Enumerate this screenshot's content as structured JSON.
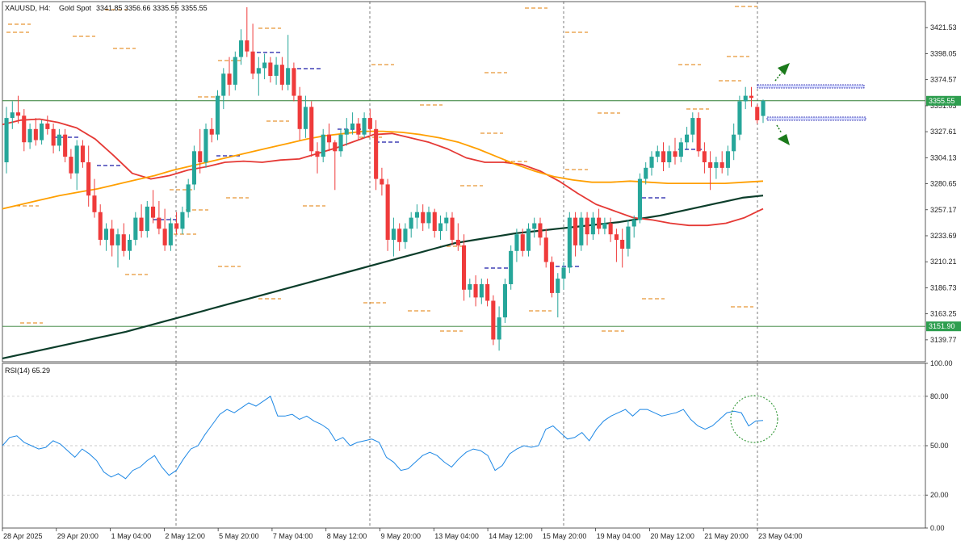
{
  "header": {
    "symbol": "XAUUSD, H4:",
    "description": "Gold Spot",
    "ohlc": "3341.85 3356.66 3335.55 3355.55"
  },
  "rsi_header": "RSI(14) 65.29",
  "colors": {
    "bull": "#26a69a",
    "bear": "#ef3b3b",
    "ma_fast": "#ff9f00",
    "ma_mid": "#e53935",
    "ma_slow": "#0b3d2a",
    "rsi": "#1e88e5",
    "pivot_orange": "#e07b00",
    "pivot_blue": "#1a1aa6",
    "level": "#2e7d32",
    "arrow": "#1b7a1b"
  },
  "price_axis": {
    "ticks": [
      "3421.53",
      "3398.05",
      "3374.57",
      "3351.03",
      "3327.61",
      "3304.13",
      "3280.65",
      "3257.17",
      "3233.69",
      "3210.21",
      "3186.73",
      "3163.25",
      "3139.77"
    ],
    "current_price_label": "3355.55",
    "support_label": "3151.90"
  },
  "rsi_axis": {
    "ticks": [
      "100.00",
      "80.00",
      "50.00",
      "20.00",
      "0.00"
    ]
  },
  "time_axis": {
    "labels": [
      "28 Apr 2025",
      "29 Apr 20:00",
      "1 May 04:00",
      "2 May 12:00",
      "5 May 20:00",
      "7 May 04:00",
      "8 May 12:00",
      "9 May 20:00",
      "13 May 04:00",
      "14 May 12:00",
      "15 May 20:00",
      "19 May 04:00",
      "20 May 12:00",
      "21 May 20:00",
      "23 May 04:00"
    ]
  },
  "chart_data": {
    "type": "candlestick",
    "symbol": "XAUUSD",
    "timeframe": "H4",
    "ylim": [
      3120,
      3445
    ],
    "levels": [
      3355.55,
      3151.9
    ],
    "candles": [
      {
        "o": 3300,
        "h": 3350,
        "l": 3290,
        "c": 3340
      },
      {
        "o": 3340,
        "h": 3355,
        "l": 3330,
        "c": 3345
      },
      {
        "o": 3345,
        "h": 3360,
        "l": 3335,
        "c": 3342
      },
      {
        "o": 3342,
        "h": 3348,
        "l": 3310,
        "c": 3318
      },
      {
        "o": 3318,
        "h": 3335,
        "l": 3312,
        "c": 3330
      },
      {
        "o": 3330,
        "h": 3340,
        "l": 3315,
        "c": 3320
      },
      {
        "o": 3320,
        "h": 3338,
        "l": 3316,
        "c": 3335
      },
      {
        "o": 3335,
        "h": 3342,
        "l": 3325,
        "c": 3330
      },
      {
        "o": 3330,
        "h": 3335,
        "l": 3308,
        "c": 3315
      },
      {
        "o": 3315,
        "h": 3330,
        "l": 3310,
        "c": 3325
      },
      {
        "o": 3325,
        "h": 3330,
        "l": 3300,
        "c": 3305
      },
      {
        "o": 3305,
        "h": 3312,
        "l": 3285,
        "c": 3290
      },
      {
        "o": 3290,
        "h": 3320,
        "l": 3275,
        "c": 3315
      },
      {
        "o": 3315,
        "h": 3320,
        "l": 3295,
        "c": 3300
      },
      {
        "o": 3300,
        "h": 3315,
        "l": 3260,
        "c": 3270
      },
      {
        "o": 3270,
        "h": 3285,
        "l": 3250,
        "c": 3255
      },
      {
        "o": 3255,
        "h": 3262,
        "l": 3225,
        "c": 3230
      },
      {
        "o": 3230,
        "h": 3245,
        "l": 3220,
        "c": 3240
      },
      {
        "o": 3240,
        "h": 3248,
        "l": 3215,
        "c": 3225
      },
      {
        "o": 3225,
        "h": 3240,
        "l": 3205,
        "c": 3235
      },
      {
        "o": 3235,
        "h": 3245,
        "l": 3215,
        "c": 3220
      },
      {
        "o": 3220,
        "h": 3235,
        "l": 3212,
        "c": 3230
      },
      {
        "o": 3230,
        "h": 3255,
        "l": 3225,
        "c": 3250
      },
      {
        "o": 3250,
        "h": 3262,
        "l": 3232,
        "c": 3238
      },
      {
        "o": 3238,
        "h": 3265,
        "l": 3232,
        "c": 3260
      },
      {
        "o": 3260,
        "h": 3275,
        "l": 3245,
        "c": 3250
      },
      {
        "o": 3250,
        "h": 3265,
        "l": 3235,
        "c": 3240
      },
      {
        "o": 3240,
        "h": 3258,
        "l": 3220,
        "c": 3225
      },
      {
        "o": 3225,
        "h": 3250,
        "l": 3220,
        "c": 3245
      },
      {
        "o": 3245,
        "h": 3255,
        "l": 3235,
        "c": 3240
      },
      {
        "o": 3240,
        "h": 3260,
        "l": 3235,
        "c": 3255
      },
      {
        "o": 3255,
        "h": 3285,
        "l": 3250,
        "c": 3280
      },
      {
        "o": 3280,
        "h": 3315,
        "l": 3275,
        "c": 3310
      },
      {
        "o": 3310,
        "h": 3330,
        "l": 3290,
        "c": 3300
      },
      {
        "o": 3300,
        "h": 3335,
        "l": 3295,
        "c": 3330
      },
      {
        "o": 3330,
        "h": 3340,
        "l": 3318,
        "c": 3325
      },
      {
        "o": 3325,
        "h": 3365,
        "l": 3320,
        "c": 3360
      },
      {
        "o": 3360,
        "h": 3385,
        "l": 3348,
        "c": 3380
      },
      {
        "o": 3380,
        "h": 3395,
        "l": 3360,
        "c": 3370
      },
      {
        "o": 3370,
        "h": 3400,
        "l": 3365,
        "c": 3395
      },
      {
        "o": 3395,
        "h": 3420,
        "l": 3388,
        "c": 3410
      },
      {
        "o": 3410,
        "h": 3440,
        "l": 3395,
        "c": 3400
      },
      {
        "o": 3400,
        "h": 3425,
        "l": 3375,
        "c": 3380
      },
      {
        "o": 3380,
        "h": 3395,
        "l": 3360,
        "c": 3385
      },
      {
        "o": 3385,
        "h": 3398,
        "l": 3375,
        "c": 3390
      },
      {
        "o": 3390,
        "h": 3395,
        "l": 3372,
        "c": 3378
      },
      {
        "o": 3378,
        "h": 3395,
        "l": 3370,
        "c": 3388
      },
      {
        "o": 3388,
        "h": 3395,
        "l": 3365,
        "c": 3370
      },
      {
        "o": 3370,
        "h": 3415,
        "l": 3365,
        "c": 3385
      },
      {
        "o": 3385,
        "h": 3390,
        "l": 3355,
        "c": 3360
      },
      {
        "o": 3360,
        "h": 3368,
        "l": 3320,
        "c": 3330
      },
      {
        "o": 3330,
        "h": 3360,
        "l": 3322,
        "c": 3350
      },
      {
        "o": 3350,
        "h": 3355,
        "l": 3305,
        "c": 3310
      },
      {
        "o": 3310,
        "h": 3318,
        "l": 3290,
        "c": 3305
      },
      {
        "o": 3305,
        "h": 3330,
        "l": 3300,
        "c": 3325
      },
      {
        "o": 3325,
        "h": 3335,
        "l": 3310,
        "c": 3318
      },
      {
        "o": 3318,
        "h": 3320,
        "l": 3275,
        "c": 3310
      },
      {
        "o": 3310,
        "h": 3330,
        "l": 3305,
        "c": 3325
      },
      {
        "o": 3325,
        "h": 3340,
        "l": 3315,
        "c": 3330
      },
      {
        "o": 3330,
        "h": 3345,
        "l": 3325,
        "c": 3335
      },
      {
        "o": 3335,
        "h": 3340,
        "l": 3320,
        "c": 3325
      },
      {
        "o": 3325,
        "h": 3345,
        "l": 3322,
        "c": 3340
      },
      {
        "o": 3340,
        "h": 3348,
        "l": 3325,
        "c": 3330
      },
      {
        "o": 3330,
        "h": 3338,
        "l": 3275,
        "c": 3285
      },
      {
        "o": 3285,
        "h": 3295,
        "l": 3270,
        "c": 3280
      },
      {
        "o": 3280,
        "h": 3285,
        "l": 3220,
        "c": 3230
      },
      {
        "o": 3230,
        "h": 3250,
        "l": 3215,
        "c": 3240
      },
      {
        "o": 3240,
        "h": 3245,
        "l": 3220,
        "c": 3228
      },
      {
        "o": 3228,
        "h": 3245,
        "l": 3222,
        "c": 3240
      },
      {
        "o": 3240,
        "h": 3255,
        "l": 3232,
        "c": 3250
      },
      {
        "o": 3250,
        "h": 3262,
        "l": 3240,
        "c": 3255
      },
      {
        "o": 3255,
        "h": 3262,
        "l": 3238,
        "c": 3245
      },
      {
        "o": 3245,
        "h": 3260,
        "l": 3240,
        "c": 3255
      },
      {
        "o": 3255,
        "h": 3258,
        "l": 3232,
        "c": 3238
      },
      {
        "o": 3238,
        "h": 3252,
        "l": 3230,
        "c": 3245
      },
      {
        "o": 3245,
        "h": 3255,
        "l": 3238,
        "c": 3250
      },
      {
        "o": 3250,
        "h": 3255,
        "l": 3225,
        "c": 3230
      },
      {
        "o": 3230,
        "h": 3245,
        "l": 3220,
        "c": 3225
      },
      {
        "o": 3225,
        "h": 3235,
        "l": 3175,
        "c": 3185
      },
      {
        "o": 3185,
        "h": 3195,
        "l": 3178,
        "c": 3190
      },
      {
        "o": 3190,
        "h": 3198,
        "l": 3170,
        "c": 3178
      },
      {
        "o": 3178,
        "h": 3195,
        "l": 3172,
        "c": 3190
      },
      {
        "o": 3190,
        "h": 3195,
        "l": 3170,
        "c": 3175
      },
      {
        "o": 3175,
        "h": 3180,
        "l": 3135,
        "c": 3140
      },
      {
        "o": 3140,
        "h": 3170,
        "l": 3130,
        "c": 3160
      },
      {
        "o": 3160,
        "h": 3195,
        "l": 3155,
        "c": 3190
      },
      {
        "o": 3190,
        "h": 3225,
        "l": 3185,
        "c": 3220
      },
      {
        "o": 3220,
        "h": 3240,
        "l": 3210,
        "c": 3235
      },
      {
        "o": 3235,
        "h": 3240,
        "l": 3215,
        "c": 3220
      },
      {
        "o": 3220,
        "h": 3245,
        "l": 3215,
        "c": 3240
      },
      {
        "o": 3240,
        "h": 3250,
        "l": 3232,
        "c": 3245
      },
      {
        "o": 3245,
        "h": 3250,
        "l": 3225,
        "c": 3232
      },
      {
        "o": 3232,
        "h": 3240,
        "l": 3205,
        "c": 3210
      },
      {
        "o": 3210,
        "h": 3215,
        "l": 3178,
        "c": 3182
      },
      {
        "o": 3182,
        "h": 3200,
        "l": 3160,
        "c": 3195
      },
      {
        "o": 3195,
        "h": 3210,
        "l": 3185,
        "c": 3205
      },
      {
        "o": 3205,
        "h": 3255,
        "l": 3200,
        "c": 3250
      },
      {
        "o": 3250,
        "h": 3255,
        "l": 3215,
        "c": 3225
      },
      {
        "o": 3225,
        "h": 3255,
        "l": 3220,
        "c": 3250
      },
      {
        "o": 3250,
        "h": 3255,
        "l": 3225,
        "c": 3235
      },
      {
        "o": 3235,
        "h": 3255,
        "l": 3230,
        "c": 3250
      },
      {
        "o": 3250,
        "h": 3258,
        "l": 3235,
        "c": 3240
      },
      {
        "o": 3240,
        "h": 3250,
        "l": 3235,
        "c": 3245
      },
      {
        "o": 3245,
        "h": 3250,
        "l": 3228,
        "c": 3235
      },
      {
        "o": 3235,
        "h": 3240,
        "l": 3210,
        "c": 3230
      },
      {
        "o": 3230,
        "h": 3240,
        "l": 3205,
        "c": 3222
      },
      {
        "o": 3222,
        "h": 3248,
        "l": 3215,
        "c": 3242
      },
      {
        "o": 3242,
        "h": 3252,
        "l": 3232,
        "c": 3248
      },
      {
        "o": 3248,
        "h": 3290,
        "l": 3245,
        "c": 3285
      },
      {
        "o": 3285,
        "h": 3300,
        "l": 3280,
        "c": 3295
      },
      {
        "o": 3295,
        "h": 3310,
        "l": 3288,
        "c": 3305
      },
      {
        "o": 3305,
        "h": 3315,
        "l": 3300,
        "c": 3310
      },
      {
        "o": 3310,
        "h": 3318,
        "l": 3292,
        "c": 3300
      },
      {
        "o": 3300,
        "h": 3315,
        "l": 3295,
        "c": 3310
      },
      {
        "o": 3310,
        "h": 3322,
        "l": 3298,
        "c": 3305
      },
      {
        "o": 3305,
        "h": 3322,
        "l": 3300,
        "c": 3318
      },
      {
        "o": 3318,
        "h": 3332,
        "l": 3312,
        "c": 3325
      },
      {
        "o": 3325,
        "h": 3345,
        "l": 3318,
        "c": 3340
      },
      {
        "o": 3340,
        "h": 3345,
        "l": 3305,
        "c": 3310
      },
      {
        "o": 3310,
        "h": 3318,
        "l": 3290,
        "c": 3300
      },
      {
        "o": 3300,
        "h": 3310,
        "l": 3275,
        "c": 3295
      },
      {
        "o": 3295,
        "h": 3305,
        "l": 3285,
        "c": 3300
      },
      {
        "o": 3300,
        "h": 3310,
        "l": 3290,
        "c": 3295
      },
      {
        "o": 3295,
        "h": 3315,
        "l": 3288,
        "c": 3310
      },
      {
        "o": 3310,
        "h": 3335,
        "l": 3302,
        "c": 3325
      },
      {
        "o": 3325,
        "h": 3360,
        "l": 3320,
        "c": 3355
      },
      {
        "o": 3355,
        "h": 3368,
        "l": 3348,
        "c": 3360
      },
      {
        "o": 3360,
        "h": 3368,
        "l": 3350,
        "c": 3358
      },
      {
        "o": 3350,
        "h": 3352,
        "l": 3335,
        "c": 3338
      },
      {
        "o": 3341.85,
        "h": 3356.66,
        "l": 3335.55,
        "c": 3355.55
      }
    ],
    "ma_fast": [
      3258,
      3262,
      3266,
      3270,
      3273,
      3276,
      3280,
      3284,
      3288,
      3293,
      3297,
      3301,
      3305,
      3309,
      3313,
      3317,
      3321,
      3324,
      3326,
      3328,
      3328,
      3327,
      3325,
      3322,
      3318,
      3312,
      3305,
      3298,
      3292,
      3287,
      3284,
      3282,
      3282,
      3283,
      3282,
      3281,
      3281,
      3281,
      3281,
      3282,
      3283
    ],
    "ma_mid": [
      3334,
      3338,
      3339,
      3336,
      3331,
      3321,
      3306,
      3290,
      3285,
      3288,
      3293,
      3296,
      3300,
      3301,
      3300,
      3302,
      3303,
      3308,
      3313,
      3319,
      3325,
      3326,
      3322,
      3318,
      3312,
      3304,
      3300,
      3300,
      3298,
      3292,
      3283,
      3272,
      3262,
      3256,
      3250,
      3248,
      3245,
      3243,
      3243,
      3245,
      3250,
      3258
    ],
    "ma_slow": [
      3123,
      3127,
      3131,
      3135,
      3139,
      3143,
      3147,
      3152,
      3157,
      3162,
      3167,
      3172,
      3177,
      3182,
      3187,
      3192,
      3197,
      3202,
      3207,
      3212,
      3217,
      3222,
      3227,
      3230,
      3233,
      3236,
      3238,
      3240,
      3242,
      3244,
      3246,
      3249,
      3252,
      3256,
      3260,
      3264,
      3268,
      3270
    ],
    "rsi": [
      50,
      55,
      56,
      52,
      50,
      48,
      49,
      53,
      51,
      47,
      43,
      48,
      45,
      41,
      34,
      31,
      33,
      30,
      35,
      37,
      41,
      44,
      37,
      32,
      35,
      42,
      48,
      50,
      57,
      63,
      69,
      72,
      70,
      73,
      76,
      74,
      77,
      80,
      68,
      68,
      69,
      66,
      68,
      65,
      63,
      60,
      53,
      55,
      50,
      52,
      53,
      54,
      52,
      43,
      40,
      35,
      36,
      40,
      44,
      46,
      44,
      40,
      37,
      42,
      46,
      48,
      47,
      44,
      35,
      38,
      45,
      48,
      50,
      49,
      50,
      60,
      62,
      58,
      54,
      55,
      58,
      53,
      60,
      65,
      68,
      70,
      72,
      68,
      72,
      72,
      70,
      68,
      69,
      70,
      72,
      66,
      62,
      60,
      62,
      66,
      70,
      71,
      70,
      62,
      65,
      65.29
    ]
  }
}
